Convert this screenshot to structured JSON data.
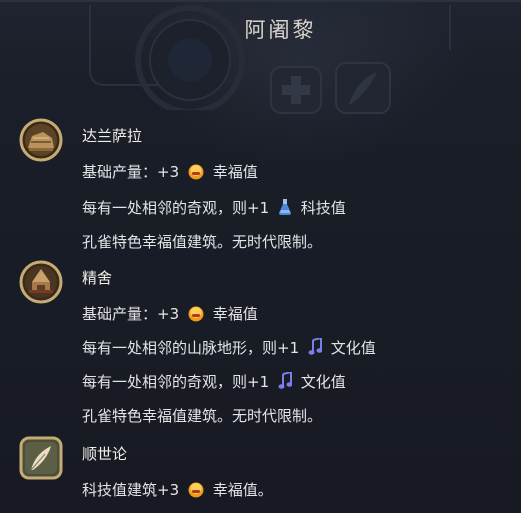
{
  "header": {
    "title": "阿阇黎"
  },
  "items": [
    {
      "name": "达兰萨拉",
      "lines": [
        {
          "before": "基础产量：+3",
          "icon": "happiness-icon",
          "after": "幸福值"
        },
        {
          "before": "每有一处相邻的奇观，则+1",
          "icon": "science-icon",
          "after": "科技值"
        },
        {
          "text": "孔雀特色幸福值建筑。无时代限制。"
        }
      ]
    },
    {
      "name": "精舍",
      "lines": [
        {
          "before": "基础产量：+3",
          "icon": "happiness-icon",
          "after": "幸福值"
        },
        {
          "before": "每有一处相邻的山脉地形，则+1",
          "icon": "culture-icon",
          "after": "文化值"
        },
        {
          "before": "每有一处相邻的奇观，则+1",
          "icon": "culture-icon",
          "after": "文化值"
        },
        {
          "text": "孔雀特色幸福值建筑。无时代限制。"
        }
      ]
    },
    {
      "name": "顺世论",
      "lines": [
        {
          "before": "科技值建筑+3",
          "icon": "happiness-icon",
          "after": "幸福值。"
        }
      ]
    }
  ],
  "colors": {
    "background": "#181c25",
    "text": "#e4e4e7",
    "happiness": "#f29a1e",
    "science": "#6d9be0",
    "culture": "#7a7fe6",
    "gold_frame": "#b79a64"
  }
}
